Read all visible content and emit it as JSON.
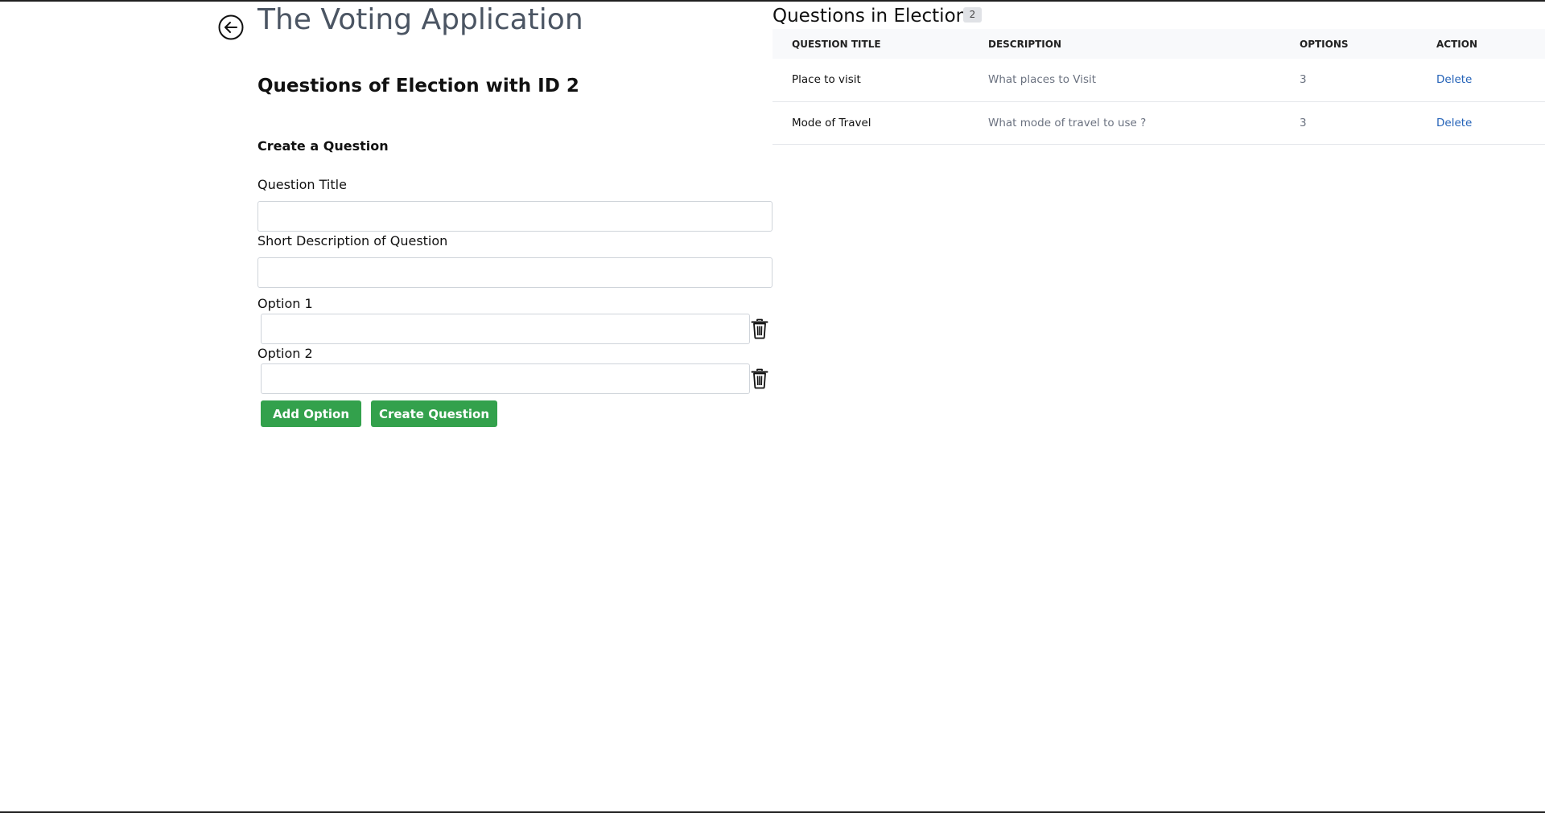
{
  "header": {
    "back_icon": "arrow-left-circle-icon",
    "app_title": "The Voting Application"
  },
  "form": {
    "page_heading": "Questions of Election with ID 2",
    "create_heading": "Create a Question",
    "question_title_label": "Question Title",
    "question_title_value": "",
    "description_label": "Short Description of Question",
    "description_value": "",
    "options": [
      {
        "label": "Option 1",
        "value": "",
        "delete_icon": "trash-icon"
      },
      {
        "label": "Option 2",
        "value": "",
        "delete_icon": "trash-icon"
      }
    ],
    "add_option_label": "Add Option",
    "create_question_label": "Create Question",
    "button_color": "#33a14c"
  },
  "questions_panel": {
    "title": "Questions in Election",
    "count": "2",
    "columns": [
      "QUESTION TITLE",
      "DESCRIPTION",
      "OPTIONS",
      "ACTION"
    ],
    "rows": [
      {
        "title": "Place to visit",
        "description": "What places to Visit",
        "options": "3",
        "action": "Delete"
      },
      {
        "title": "Mode of Travel",
        "description": "What mode of travel to use ?",
        "options": "3",
        "action": "Delete"
      }
    ],
    "link_color": "#2563b8"
  }
}
